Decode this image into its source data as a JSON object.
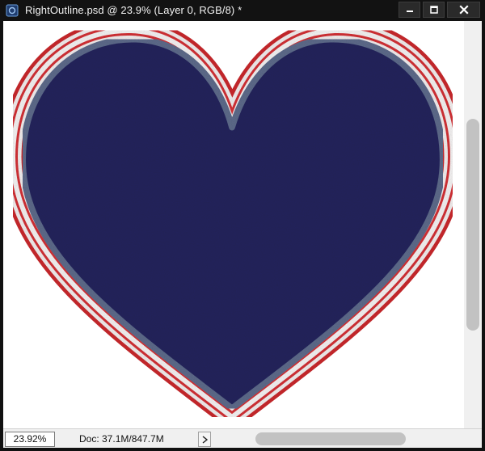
{
  "window": {
    "title": "RightOutline.psd @ 23.9% (Layer 0, RGB/8) *",
    "doc_icon": "photoshop-document-icon"
  },
  "window_controls": {
    "minimize_icon": "minimize-icon",
    "maximize_icon": "maximize-icon",
    "close_icon": "close-icon"
  },
  "canvas": {
    "artwork": "heart-shape-with-red-white-blue-outline",
    "colors": {
      "fill": "#24245c",
      "outer_outline": "#c8282c",
      "middle_outline": "#f0ecec",
      "inner_outline": "#5d6a8a",
      "background": "#ffffff"
    }
  },
  "status_bar": {
    "zoom": "23.92%",
    "doc_info": "Doc: 37.1M/847.7M",
    "menu_arrow_icon": "chevron-right-icon"
  }
}
